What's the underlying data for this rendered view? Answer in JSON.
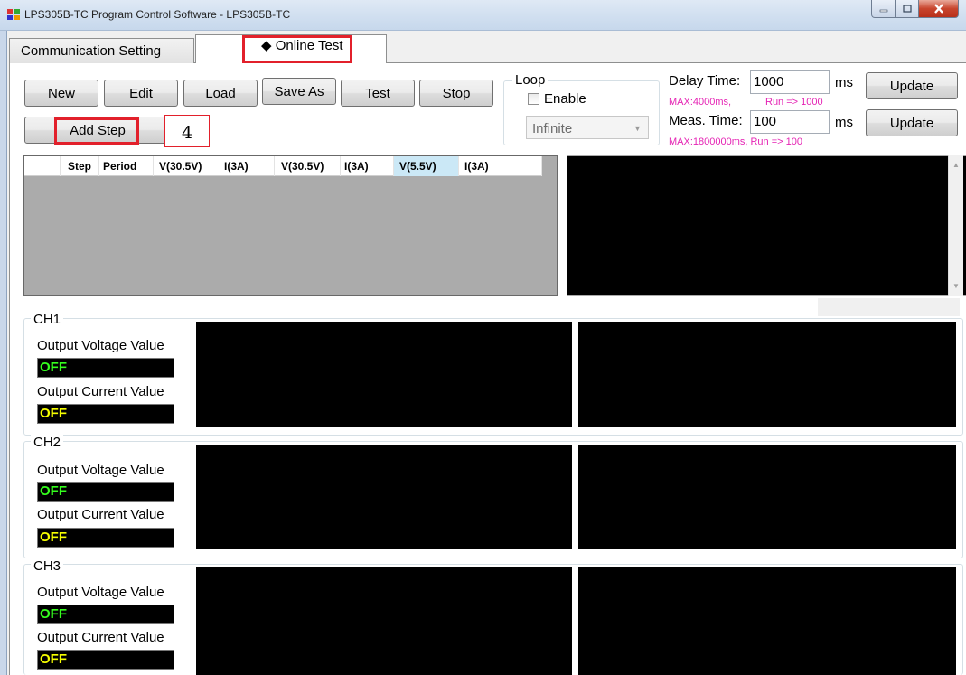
{
  "window": {
    "title": "LPS305B-TC Program Control Software - LPS305B-TC",
    "icons": [
      "app-icon",
      "minimize-icon",
      "maximize-icon",
      "close-icon"
    ]
  },
  "tabs": [
    {
      "label": "Communication Setting"
    },
    {
      "label": "Online Test",
      "glyph": "◆"
    }
  ],
  "toolbar": {
    "new": "New",
    "edit": "Edit",
    "load": "Load",
    "save_as": "Save As",
    "test": "Test",
    "stop": "Stop",
    "add_step": "Add Step"
  },
  "annotation": {
    "step_number": "4"
  },
  "loop": {
    "legend": "Loop",
    "enable_label": "Enable",
    "enabled": false,
    "select_value": "Infinite"
  },
  "delay": {
    "label": "Delay Time:",
    "value": "1000",
    "unit": "ms",
    "hint_max": "MAX:4000ms,",
    "hint_run": "Run => 1000",
    "update": "Update"
  },
  "meas": {
    "label": "Meas. Time:",
    "value": "100",
    "unit": "ms",
    "hint": "MAX:1800000ms, Run => 100",
    "update": "Update"
  },
  "grid": {
    "columns": [
      "",
      "Step",
      "Period",
      "V(30.5V)",
      "I(3A)",
      "V(30.5V)",
      "I(3A)",
      "V(5.5V)",
      "I(3A)"
    ],
    "selected_column": 7
  },
  "channels": [
    {
      "name": "CH1",
      "voltage_label": "Output Voltage Value",
      "voltage": "OFF",
      "current_label": "Output Current Value",
      "current": "OFF"
    },
    {
      "name": "CH2",
      "voltage_label": "Output Voltage Value",
      "voltage": "OFF",
      "current_label": "Output Current Value",
      "current": "OFF"
    },
    {
      "name": "CH3",
      "voltage_label": "Output Voltage Value",
      "voltage": "OFF",
      "current_label": "Output Current Value",
      "current": "OFF"
    }
  ],
  "colors": {
    "highlight": "#e2202b",
    "hint_text": "#e523b4",
    "voltage_text": "#35ff1e",
    "current_text": "#f6ff00"
  }
}
